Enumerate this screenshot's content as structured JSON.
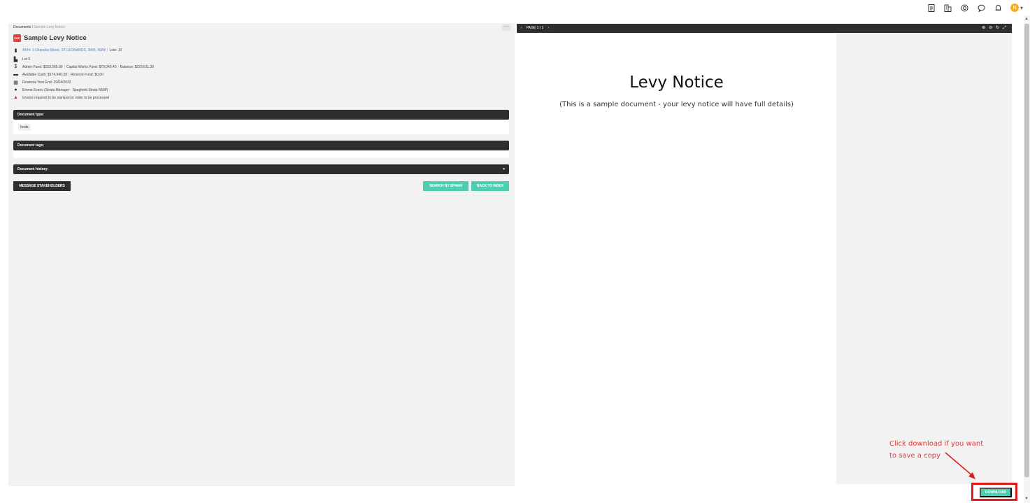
{
  "topbar": {
    "icons": [
      "document-icon",
      "building-icon",
      "help-icon",
      "chat-icon",
      "bell-icon"
    ],
    "avatar_initial": "N"
  },
  "breadcrumb": {
    "root": "Documents",
    "separator": "/",
    "current": "Sample Levy Notice"
  },
  "document": {
    "title": "Sample Levy Notice",
    "file_badge": "PDF",
    "building": "4444: 1 Chandos Street, ST LEONARDS, 2065, NSW",
    "lots_label": "Lots:",
    "lots_value": "10",
    "lot": "Lot 5",
    "admin_fund": "Admin Fund: $153,565.99",
    "capital_fund": "Capital Works Fund: $70,045.40",
    "balance": "Balance: $223,611.39",
    "available_cash": "Available Cash: $174,940.39",
    "reserve_fund": "Reserve Fund: $0.00",
    "financial_year_end": "Financial Year End: 29/04/2022",
    "manager": "Emma Evans (Strata Manager - Spaghetti Strata NSW)",
    "stamp_warning": "Invoice required to be stamped in order to be processed"
  },
  "sections": {
    "doc_type_label": "Document type:",
    "doc_type_value": "Invits",
    "doc_tags_label": "Document tags:",
    "doc_history_label": "Document history:"
  },
  "buttons": {
    "message": "MESSAGE STAKEHOLDERS",
    "search_by": "SEARCH BY SP4444",
    "back": "BACK TO INDEX",
    "download": "DOWNLOAD"
  },
  "viewer": {
    "page_label": "PAGE 1 / 1",
    "doc_heading": "Levy Notice",
    "doc_subtext": "(This is a sample document - your levy notice will have full details)"
  },
  "annotation": {
    "line1": "Click download if you want",
    "line2": "to save a copy",
    "color": "#e53935"
  },
  "colors": {
    "accent": "#4ccfb0",
    "dark_bar": "#2e2e2e",
    "pdf_red": "#e0443c"
  }
}
